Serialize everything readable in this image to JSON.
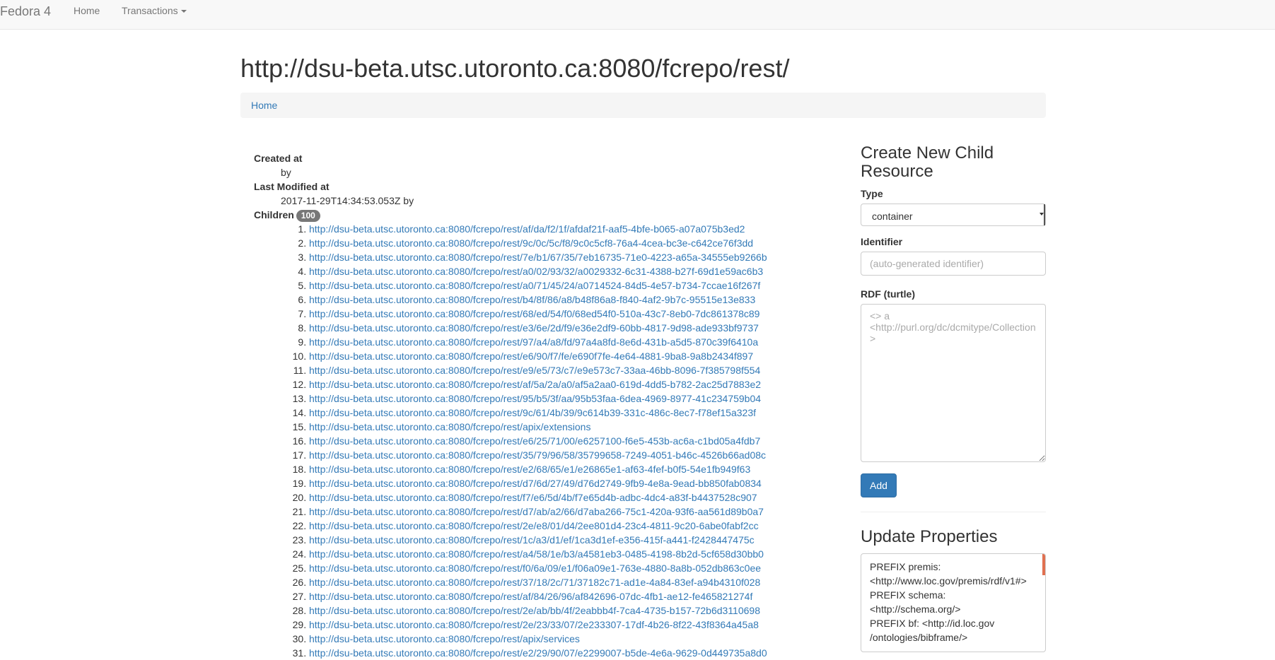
{
  "navbar": {
    "brand": "Fedora 4",
    "home": "Home",
    "transactions": "Transactions"
  },
  "page_title": "http://dsu-beta.utsc.utoronto.ca:8080/fcrepo/rest/",
  "breadcrumb": {
    "home": "Home"
  },
  "properties": {
    "created_label": "Created at",
    "created_by": "by",
    "modified_label": "Last Modified at",
    "modified_value": "2017-11-29T14:34:53.053Z by",
    "children_label": "Children",
    "children_count": "100"
  },
  "children": [
    "http://dsu-beta.utsc.utoronto.ca:8080/fcrepo/rest/af/da/f2/1f/afdaf21f-aaf5-4bfe-b065-a07a075b3ed2",
    "http://dsu-beta.utsc.utoronto.ca:8080/fcrepo/rest/9c/0c/5c/f8/9c0c5cf8-76a4-4cea-bc3e-c642ce76f3dd",
    "http://dsu-beta.utsc.utoronto.ca:8080/fcrepo/rest/7e/b1/67/35/7eb16735-71e0-4223-a65a-34555eb9266b",
    "http://dsu-beta.utsc.utoronto.ca:8080/fcrepo/rest/a0/02/93/32/a0029332-6c31-4388-b27f-69d1e59ac6b3",
    "http://dsu-beta.utsc.utoronto.ca:8080/fcrepo/rest/a0/71/45/24/a0714524-84d5-4e57-b734-7ccae16f267f",
    "http://dsu-beta.utsc.utoronto.ca:8080/fcrepo/rest/b4/8f/86/a8/b48f86a8-f840-4af2-9b7c-95515e13e833",
    "http://dsu-beta.utsc.utoronto.ca:8080/fcrepo/rest/68/ed/54/f0/68ed54f0-510a-43c7-8eb0-7dc861378c89",
    "http://dsu-beta.utsc.utoronto.ca:8080/fcrepo/rest/e3/6e/2d/f9/e36e2df9-60bb-4817-9d98-ade933bf9737",
    "http://dsu-beta.utsc.utoronto.ca:8080/fcrepo/rest/97/a4/a8/fd/97a4a8fd-8e6d-431b-a5d5-870c39f6410a",
    "http://dsu-beta.utsc.utoronto.ca:8080/fcrepo/rest/e6/90/f7/fe/e690f7fe-4e64-4881-9ba8-9a8b2434f897",
    "http://dsu-beta.utsc.utoronto.ca:8080/fcrepo/rest/e9/e5/73/c7/e9e573c7-33aa-46bb-8096-7f385798f554",
    "http://dsu-beta.utsc.utoronto.ca:8080/fcrepo/rest/af/5a/2a/a0/af5a2aa0-619d-4dd5-b782-2ac25d7883e2",
    "http://dsu-beta.utsc.utoronto.ca:8080/fcrepo/rest/95/b5/3f/aa/95b53faa-6dea-4969-8977-41c234759b04",
    "http://dsu-beta.utsc.utoronto.ca:8080/fcrepo/rest/9c/61/4b/39/9c614b39-331c-486c-8ec7-f78ef15a323f",
    "http://dsu-beta.utsc.utoronto.ca:8080/fcrepo/rest/apix/extensions",
    "http://dsu-beta.utsc.utoronto.ca:8080/fcrepo/rest/e6/25/71/00/e6257100-f6e5-453b-ac6a-c1bd05a4fdb7",
    "http://dsu-beta.utsc.utoronto.ca:8080/fcrepo/rest/35/79/96/58/35799658-7249-4051-b46c-4526b66ad08c",
    "http://dsu-beta.utsc.utoronto.ca:8080/fcrepo/rest/e2/68/65/e1/e26865e1-af63-4fef-b0f5-54e1fb949f63",
    "http://dsu-beta.utsc.utoronto.ca:8080/fcrepo/rest/d7/6d/27/49/d76d2749-9fb9-4e8a-9ead-bb850fab0834",
    "http://dsu-beta.utsc.utoronto.ca:8080/fcrepo/rest/f7/e6/5d/4b/f7e65d4b-adbc-4dc4-a83f-b4437528c907",
    "http://dsu-beta.utsc.utoronto.ca:8080/fcrepo/rest/d7/ab/a2/66/d7aba266-75c1-420a-93f6-aa561d89b0a7",
    "http://dsu-beta.utsc.utoronto.ca:8080/fcrepo/rest/2e/e8/01/d4/2ee801d4-23c4-4811-9c20-6abe0fabf2cc",
    "http://dsu-beta.utsc.utoronto.ca:8080/fcrepo/rest/1c/a3/d1/ef/1ca3d1ef-e356-415f-a441-f2428447475c",
    "http://dsu-beta.utsc.utoronto.ca:8080/fcrepo/rest/a4/58/1e/b3/a4581eb3-0485-4198-8b2d-5cf658d30bb0",
    "http://dsu-beta.utsc.utoronto.ca:8080/fcrepo/rest/f0/6a/09/e1/f06a09e1-763e-4880-8a8b-052db863c0ee",
    "http://dsu-beta.utsc.utoronto.ca:8080/fcrepo/rest/37/18/2c/71/37182c71-ad1e-4a84-83ef-a94b4310f028",
    "http://dsu-beta.utsc.utoronto.ca:8080/fcrepo/rest/af/84/26/96/af842696-07dc-4fb1-ae12-fe465821274f",
    "http://dsu-beta.utsc.utoronto.ca:8080/fcrepo/rest/2e/ab/bb/4f/2eabbb4f-7ca4-4735-b157-72b6d3110698",
    "http://dsu-beta.utsc.utoronto.ca:8080/fcrepo/rest/2e/23/33/07/2e233307-17df-4b26-8f22-43f8364a45a8",
    "http://dsu-beta.utsc.utoronto.ca:8080/fcrepo/rest/apix/services",
    "http://dsu-beta.utsc.utoronto.ca:8080/fcrepo/rest/e2/29/90/07/e2299007-b5de-4e6a-9629-0d449735a8d0"
  ],
  "create": {
    "heading": "Create New Child Resource",
    "type_label": "Type",
    "type_value": "container",
    "identifier_label": "Identifier",
    "identifier_placeholder": "(auto-generated identifier)",
    "rdf_label": "RDF (turtle)",
    "rdf_placeholder": "<> a <http://purl.org/dc/dcmitype/Collection>",
    "add_label": "Add"
  },
  "update": {
    "heading": "Update Properties",
    "lines": [
      "PREFIX premis:",
      "<http://www.loc.gov/premis/rdf/v1#>",
      "PREFIX schema:",
      "<http://schema.org/>",
      "PREFIX bf: <http://id.loc.gov",
      "/ontologies/bibframe/>"
    ]
  }
}
